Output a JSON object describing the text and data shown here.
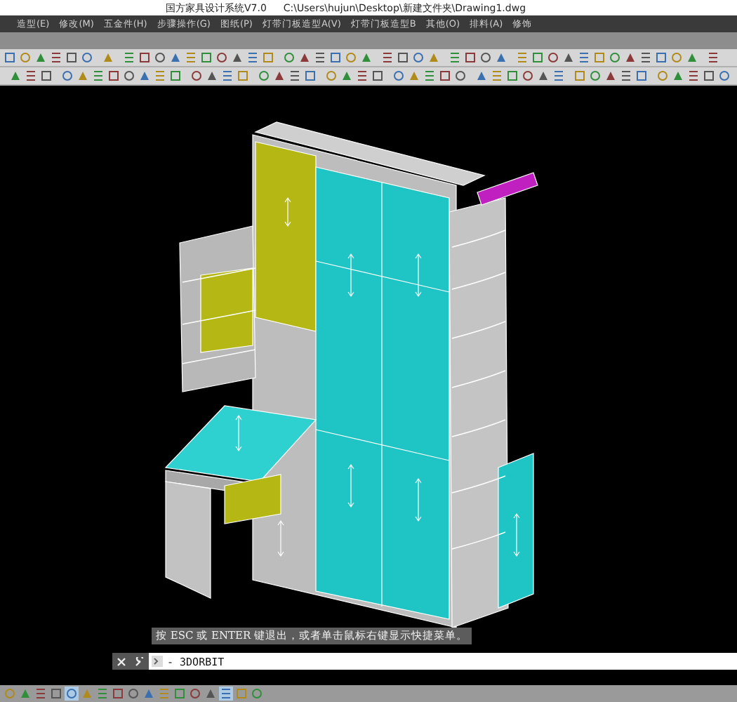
{
  "window": {
    "title": "国方家具设计系统V7.0",
    "path": "C:\\Users\\hujun\\Desktop\\新建文件夹\\Drawing1.dwg"
  },
  "menu": [
    {
      "label": "造型(E)"
    },
    {
      "label": "修改(M)"
    },
    {
      "label": "五金件(H)"
    },
    {
      "label": "步骤操作(G)"
    },
    {
      "label": "图纸(P)"
    },
    {
      "label": "灯带门板造型A(V)"
    },
    {
      "label": "灯带门板造型B"
    },
    {
      "label": "其他(O)"
    },
    {
      "label": "排料(A)"
    },
    {
      "label": "修饰"
    }
  ],
  "command": {
    "prompt": "按 ESC 或 ENTER 键退出，或者单击鼠标右键显示快捷菜单。",
    "value": "- 3DORBIT"
  }
}
